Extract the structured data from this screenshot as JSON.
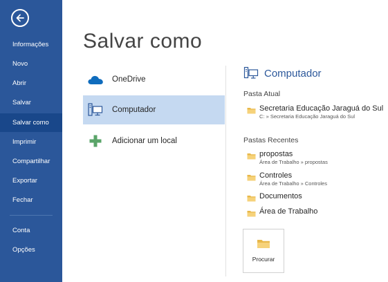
{
  "colors": {
    "sidebar_bg": "#2b579a",
    "sidebar_selected": "#19478a",
    "selected_location_bg": "#c5d9f1",
    "accent_text": "#2b579a"
  },
  "sidebar": {
    "back_icon": "back-arrow-icon",
    "items": [
      {
        "label": "Informações"
      },
      {
        "label": "Novo"
      },
      {
        "label": "Abrir"
      },
      {
        "label": "Salvar"
      },
      {
        "label": "Salvar como",
        "selected": true
      },
      {
        "label": "Imprimir"
      },
      {
        "label": "Compartilhar"
      },
      {
        "label": "Exportar"
      },
      {
        "label": "Fechar"
      },
      {
        "label": "Conta"
      },
      {
        "label": "Opções"
      }
    ]
  },
  "main": {
    "title": "Salvar como",
    "locations": [
      {
        "label": "OneDrive",
        "icon": "cloud-icon"
      },
      {
        "label": "Computador",
        "icon": "computer-icon",
        "selected": true
      },
      {
        "label": "Adicionar um local",
        "icon": "plus-icon"
      }
    ]
  },
  "right_panel": {
    "title": "Computador",
    "current_folder_label": "Pasta Atual",
    "current_folder": {
      "name": "Secretaria Educação Jaraguá do Sul",
      "path": "C: » Secretaria Educação Jaraguá do Sul"
    },
    "recent_label": "Pastas Recentes",
    "recent_folders": [
      {
        "name": "propostas",
        "path": "Área de Trabalho » propostas"
      },
      {
        "name": "Controles",
        "path": "Área de Trabalho » Controles"
      },
      {
        "name": "Documentos",
        "path": ""
      },
      {
        "name": "Área de Trabalho",
        "path": ""
      }
    ],
    "browse_label": "Procurar",
    "browse_icon": "folder-icon"
  }
}
